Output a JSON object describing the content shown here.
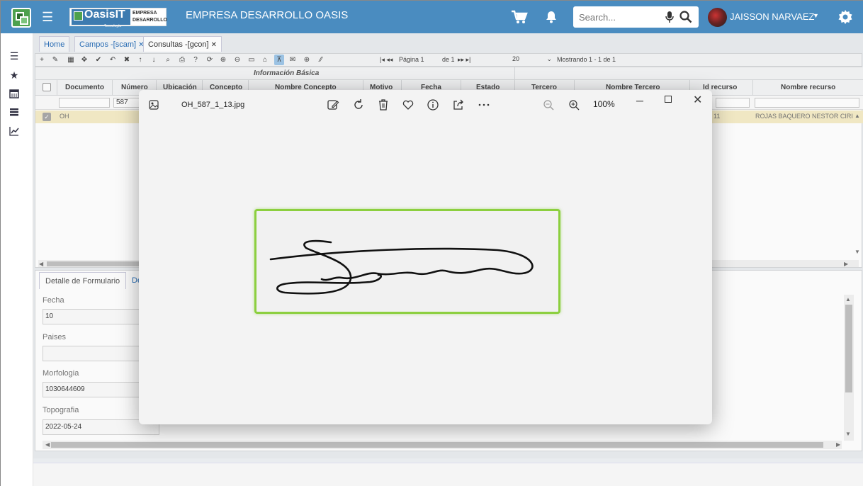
{
  "header": {
    "app_title": "EMPRESA DESARROLLO OASIS",
    "brand_name": "OasisIT",
    "brand_tagline": "Tecnología",
    "brand_company_line1": "EMPRESA",
    "brand_company_line2": "DESARROLLO",
    "search_placeholder": "Search...",
    "user_name": "JAISSON NARVAEZ",
    "accent_color": "#4a8cc0"
  },
  "sidebar": {
    "icons": [
      "menu-icon",
      "star-icon",
      "calendar-icon",
      "list-icon",
      "chart-line-icon"
    ]
  },
  "tabs": [
    {
      "label": "Home"
    },
    {
      "label": "Campos -[scam]",
      "closable": true
    },
    {
      "label": "Consultas -[gcon]",
      "closable": true,
      "active": true
    }
  ],
  "pager": {
    "page_label": "Página 1",
    "of_label": "de 1",
    "rows_per_page": "20",
    "showing": "Mostrando 1 - 1 de 1"
  },
  "grid": {
    "group_label": "Información Básica",
    "columns": [
      "Documento",
      "Número",
      "Ubicación",
      "Concepto",
      "Nombre Concepto",
      "Motivo",
      "Fecha",
      "Estado",
      "Tercero",
      "Nombre Tercero",
      "Id recurso",
      "Nombre recurso"
    ],
    "filter_numero": "587",
    "row": {
      "documento": "OH",
      "id_recurso_partial": "11",
      "nombre_recurso": "ROJAS BAQUERO NESTOR CIRI"
    }
  },
  "detail": {
    "tab_active": "Detalle de Formulario",
    "tab_other": "De",
    "fields": [
      {
        "label": "Fecha",
        "value": "10"
      },
      {
        "label": "Paises",
        "value": ""
      },
      {
        "label": "Morfologia",
        "value": "1030644609"
      },
      {
        "label": "Topografia",
        "value": "2022-05-24"
      }
    ]
  },
  "viewer": {
    "filename": "OH_587_1_13.jpg",
    "zoom": "100%",
    "highlight_color": "#8ccf3f"
  }
}
